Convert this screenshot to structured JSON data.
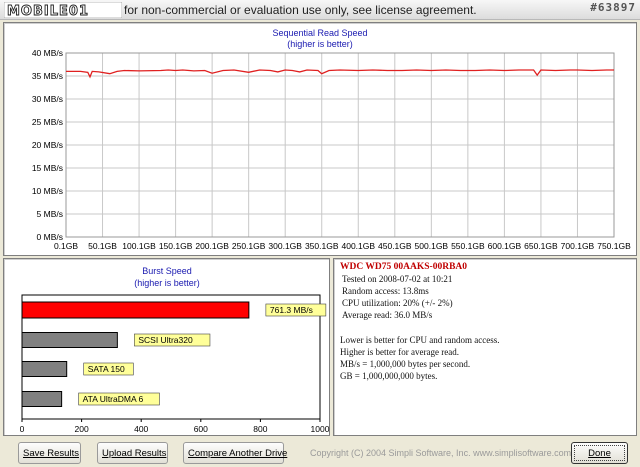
{
  "titlebar": {
    "logo_text": "MOBILE01",
    "license_notice": "for non-commercial or evaluation use only, see license agreement.",
    "watermark": "#63897"
  },
  "chart_data": [
    {
      "type": "line",
      "title": "Sequential Read Speed",
      "subtitle": "(higher is better)",
      "x_tick_labels": [
        "0.1GB",
        "50.1GB",
        "100.1GB",
        "150.1GB",
        "200.1GB",
        "250.1GB",
        "300.1GB",
        "350.1GB",
        "400.1GB",
        "450.1GB",
        "500.1GB",
        "550.1GB",
        "600.1GB",
        "650.1GB",
        "700.1GB",
        "750.1GB"
      ],
      "xlim": [
        0.1,
        750.1
      ],
      "y_ticks": [
        0,
        5,
        10,
        15,
        20,
        25,
        30,
        35,
        40
      ],
      "y_tick_labels": [
        "0 MB/s",
        "5 MB/s",
        "10 MB/s",
        "15 MB/s",
        "20 MB/s",
        "25 MB/s",
        "30 MB/s",
        "35 MB/s",
        "40 MB/s"
      ],
      "ylim": [
        0,
        40
      ],
      "grid": true,
      "line_color": "#e02020",
      "series": [
        {
          "x": [
            0.1,
            20,
            30,
            33,
            36,
            45,
            60,
            70,
            80,
            100,
            130,
            140,
            150,
            160,
            175,
            190,
            200,
            215,
            230,
            250,
            265,
            280,
            290,
            300,
            310,
            320,
            330,
            345,
            350,
            360,
            375,
            400,
            420,
            440,
            460,
            480,
            500,
            520,
            540,
            560,
            580,
            600,
            620,
            640,
            645,
            650,
            670,
            690,
            700,
            720,
            740,
            750.1
          ],
          "y": [
            36.0,
            36.0,
            35.8,
            34.8,
            36.0,
            35.9,
            35.5,
            36.0,
            36.2,
            36.1,
            36.2,
            36.3,
            36.2,
            36.3,
            36.1,
            36.2,
            35.6,
            36.2,
            36.3,
            35.8,
            36.3,
            36.2,
            35.9,
            36.3,
            36.2,
            35.9,
            36.3,
            36.2,
            35.5,
            36.2,
            36.3,
            36.2,
            36.3,
            36.2,
            36.2,
            36.3,
            36.2,
            36.3,
            36.2,
            36.2,
            36.3,
            36.2,
            36.3,
            36.3,
            35.2,
            36.3,
            36.2,
            36.3,
            36.3,
            36.2,
            36.3,
            36.3
          ]
        }
      ]
    },
    {
      "type": "bar",
      "orientation": "horizontal",
      "title": "Burst Speed",
      "subtitle": "(higher is better)",
      "categories": [
        "761.3 MB/s",
        "SCSI Ultra320",
        "SATA 150",
        "ATA UltraDMA 6"
      ],
      "values": [
        761.3,
        320,
        150,
        133
      ],
      "colors": [
        "#ff0000",
        "#808080",
        "#808080",
        "#808080"
      ],
      "xlim": [
        0,
        1000
      ],
      "x_ticks": [
        0,
        200,
        400,
        600,
        800,
        1000
      ],
      "x_tick_labels": [
        "0",
        "200",
        "400",
        "600",
        "800",
        "1000"
      ],
      "grid": false
    }
  ],
  "info": {
    "drive_name": "WDC WD75 00AAKS-00RBA0",
    "tested_on": "Tested on 2008-07-02 at 10:21",
    "random_access": "Random access: 13.8ms",
    "cpu_utilization": "CPU utilization: 20% (+/- 2%)",
    "average_read": "Average read: 36.0 MB/s",
    "notes": [
      "Lower is better for CPU and random access.",
      "Higher is better for average read.",
      "MB/s = 1,000,000 bytes per second.",
      "GB = 1,000,000,000 bytes."
    ]
  },
  "buttons": {
    "save": "Save Results",
    "upload": "Upload Results",
    "compare": "Compare Another Drive",
    "done": "Done"
  },
  "copyright": "Copyright (C) 2004 Simpli Software, Inc. www.simplisoftware.com"
}
